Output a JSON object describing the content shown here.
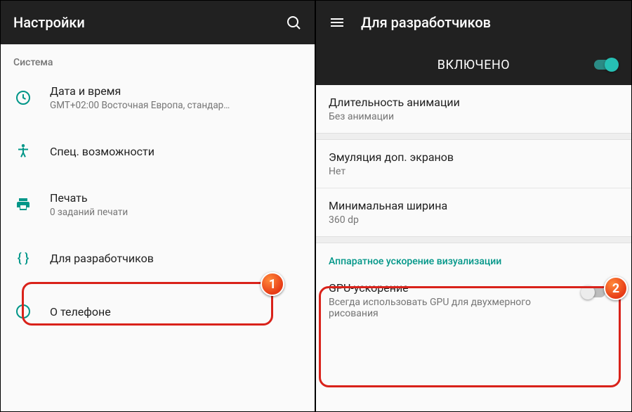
{
  "left": {
    "appbar_title": "Настройки",
    "section_system": "Система",
    "rows": {
      "datetime": {
        "title": "Дата и время",
        "sub": "GMT+02:00 Восточная Европа, стандар…"
      },
      "accessibility": {
        "title": "Спец. возможности"
      },
      "print": {
        "title": "Печать",
        "sub": "0 заданий печати"
      },
      "developer": {
        "title": "Для разработчиков"
      },
      "about": {
        "title": "О телефоне"
      }
    }
  },
  "right": {
    "appbar_title": "Для разработчиков",
    "enabled_label": "ВКЛЮЧЕНО",
    "rows": {
      "anim_duration": {
        "title": "Длительность анимации",
        "sub": "Без анимации"
      },
      "simulate_displays": {
        "title": "Эмуляция доп. экранов",
        "sub": "Нет"
      },
      "min_width": {
        "title": "Минимальная ширина",
        "sub": "360 dp"
      },
      "section_hw": "Аппаратное ускорение визуализации",
      "gpu": {
        "title": "GPU-ускорение",
        "sub": "Всегда использовать GPU для двухмерного рисования"
      }
    }
  },
  "markers": {
    "one": "1",
    "two": "2"
  }
}
